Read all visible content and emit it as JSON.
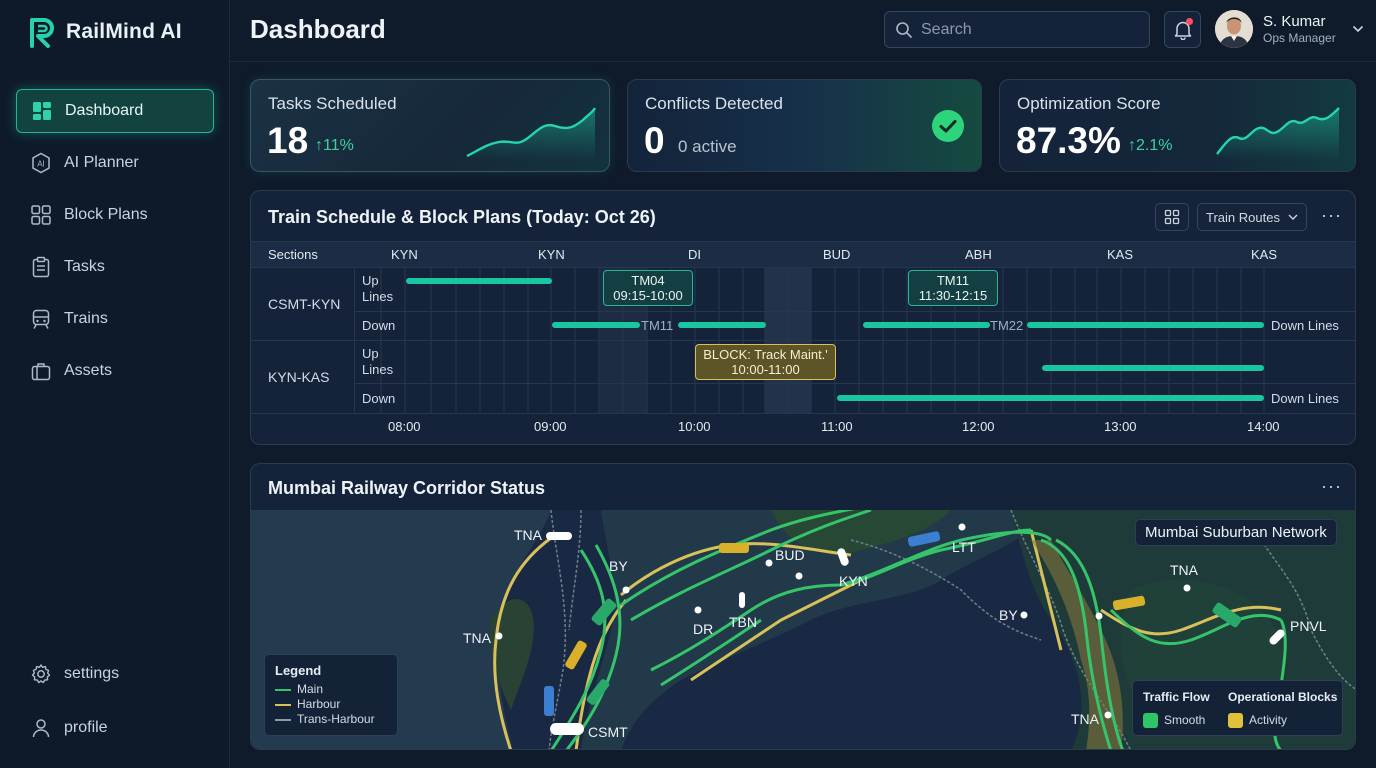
{
  "app": {
    "name": "RailMind AI"
  },
  "sidebar": {
    "items": [
      {
        "label": "Dashboard",
        "icon": "dashboard-icon",
        "active": true
      },
      {
        "label": "AI Planner",
        "icon": "ai-chip-icon"
      },
      {
        "label": "Block Plans",
        "icon": "grid-icon"
      },
      {
        "label": "Tasks",
        "icon": "clipboard-icon"
      },
      {
        "label": "Trains",
        "icon": "train-icon"
      },
      {
        "label": "Assets",
        "icon": "briefcase-icon"
      }
    ],
    "bottom": [
      {
        "label": "settings",
        "icon": "gear-icon"
      },
      {
        "label": "profile",
        "icon": "user-icon"
      }
    ]
  },
  "header": {
    "title": "Dashboard",
    "search_placeholder": "Search",
    "user": {
      "name": "S. Kumar",
      "role": "Ops Manager"
    }
  },
  "kpis": [
    {
      "label": "Tasks Scheduled",
      "value": "18",
      "delta": "11%"
    },
    {
      "label": "Conflicts Detected",
      "value": "0",
      "sub": "0 active"
    },
    {
      "label": "Optimization Score",
      "value": "87.3%",
      "delta": "2.1%"
    }
  ],
  "schedule": {
    "title": "Train Schedule & Block Plans (Today: Oct 26)",
    "filter_label": "Train Routes",
    "sections_header": "Sections",
    "station_headers": [
      "KYN",
      "KYN",
      "DI",
      "BUD",
      "ABH",
      "KAS",
      "KAS"
    ],
    "time_labels": [
      "08:00",
      "09:00",
      "10:00",
      "11:00",
      "12:00",
      "13:00",
      "14:00"
    ],
    "sections": [
      {
        "name": "CSMT-KYN",
        "up_label": "Up Lines",
        "down_label": "Down"
      },
      {
        "name": "KYN-KAS",
        "up_label": "Up Lines",
        "down_label": "Down"
      }
    ],
    "down_lines_label": "Down Lines",
    "tm04": {
      "line1": "TM04",
      "line2": "09:15-10:00"
    },
    "tm11_box": {
      "line1": "TM11",
      "line2": "11:30-12:15"
    },
    "tm11_bar": "TM11",
    "tm22_bar": "TM22",
    "block": {
      "line1": "BLOCK: Track Maint.'",
      "line2": "10:00-11:00"
    }
  },
  "map": {
    "title": "Mumbai Railway Corridor Status",
    "network_label": "Mumbai Suburban Network",
    "stations": [
      "TNA",
      "BY",
      "BUD",
      "KYN",
      "LTT",
      "TNA",
      "DR",
      "TBN",
      "CSMT",
      "BY",
      "TNA",
      "PNVL",
      "TNA"
    ],
    "legend": {
      "title": "Legend",
      "items": [
        {
          "label": "Main",
          "color": "#35c46a"
        },
        {
          "label": "Harbour",
          "color": "#d8c05a"
        },
        {
          "label": "Trans-Harbour",
          "color": "#8a9aa8"
        }
      ]
    },
    "traffic": {
      "flow_title": "Traffic Flow",
      "flow_label": "Smooth",
      "flow_color": "#2fc466",
      "blocks_title": "Operational Blocks",
      "blocks_label": "Activity",
      "blocks_color": "#e0c23a"
    }
  },
  "colors": {
    "accent": "#1fb59a",
    "bar": "#19c6a0",
    "bg": "#0f1b2b"
  }
}
